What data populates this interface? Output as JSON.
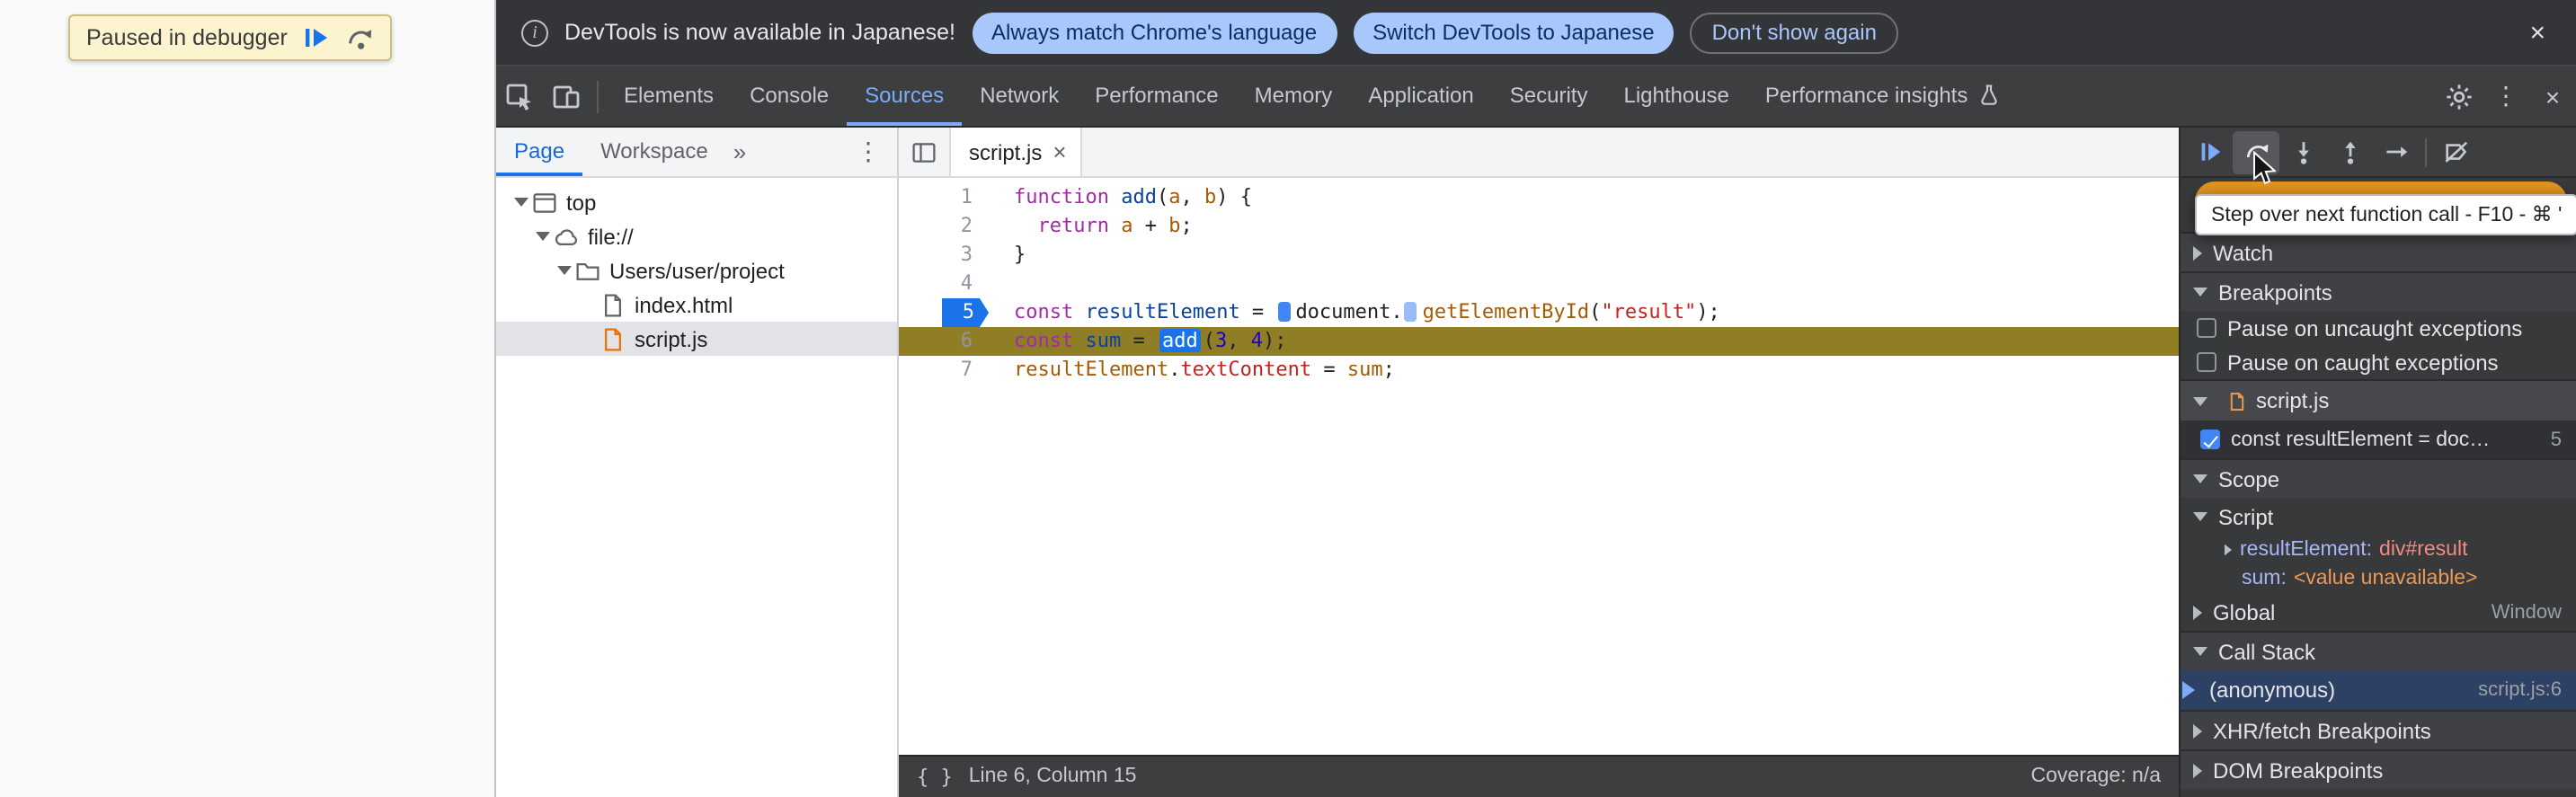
{
  "page": {
    "banner": {
      "text": "Paused in debugger"
    }
  },
  "icons": {
    "info": "i",
    "close": "×",
    "more": "⋮",
    "chevrons": "»",
    "list": [
      "info-icon",
      "close-icon",
      "inspect-element-icon",
      "device-toolbar-icon",
      "flask-icon",
      "settings-gear-icon",
      "more-options-icon",
      "toggle-navigator-icon",
      "frame-icon",
      "cloud-icon",
      "folder-icon",
      "file-icon",
      "resume-icon",
      "step-over-icon",
      "step-into-icon",
      "step-out-icon",
      "step-icon",
      "deactivate-breakpoints-icon",
      "pretty-print-icon",
      "breakpoint-marker",
      "inline-breakpoint-marker",
      "mouse-cursor"
    ]
  },
  "infobar": {
    "message": "DevTools is now available in Japanese!",
    "buttons": [
      "Always match Chrome's language",
      "Switch DevTools to Japanese",
      "Don't show again"
    ]
  },
  "toolbar": {
    "tabs": [
      "Elements",
      "Console",
      "Sources",
      "Network",
      "Performance",
      "Memory",
      "Application",
      "Security",
      "Lighthouse",
      "Performance insights"
    ],
    "selected_tab": "Sources"
  },
  "navigator": {
    "tabs": [
      "Page",
      "Workspace"
    ],
    "selected_tab": "Page",
    "tree": [
      {
        "label": "top"
      },
      {
        "label": "file://"
      },
      {
        "label": "Users/user/project"
      },
      {
        "label": "index.html"
      },
      {
        "label": "script.js"
      }
    ]
  },
  "editor": {
    "tab": "script.js",
    "gutter": [
      "1",
      "2",
      "3",
      "4",
      "5",
      "6",
      "7"
    ],
    "breakpoint_line": 5,
    "paused_line": 6,
    "code": [
      [
        "function",
        " ",
        "add",
        "(",
        "a",
        ", ",
        "b",
        ") {"
      ],
      [
        "  ",
        "return",
        " ",
        "a",
        " + ",
        "b",
        ";"
      ],
      [
        "}"
      ],
      [
        ""
      ],
      [
        "const",
        " ",
        "resultElement",
        " = ",
        "document",
        ".",
        "getElementById",
        "(",
        "\"result\"",
        ");"
      ],
      [
        "const",
        " ",
        "sum",
        " = ",
        "add",
        "(",
        "3",
        ", ",
        "4",
        ");"
      ],
      [
        "resultElement",
        ".",
        "textContent",
        " = ",
        "sum",
        ";"
      ]
    ],
    "status": {
      "braces": "{ }",
      "position": "Line 6, Column 15",
      "coverage": "Coverage: n/a"
    }
  },
  "sidebar": {
    "tooltip": "Step over next function call - F10 - ⌘ '",
    "watch": "Watch",
    "breakpoints": "Breakpoints",
    "pause_uncaught": "Pause on uncaught exceptions",
    "pause_caught": "Pause on caught exceptions",
    "bp_group_file": "script.js",
    "bp_entry": "const resultElement = doc…",
    "bp_entry_line": "5",
    "scope": "Scope",
    "scope_script": "Script",
    "var_result_name": "resultElement:",
    "var_result_value": "div#result",
    "var_sum_name": "sum:",
    "var_sum_value": "<value unavailable>",
    "global": "Global",
    "global_value": "Window",
    "callstack": "Call Stack",
    "frame_name": "(anonymous)",
    "frame_location": "script.js:6",
    "xhr": "XHR/fetch Breakpoints",
    "dom": "DOM Breakpoints"
  },
  "colors": {
    "accent_blue": "#1a73e8",
    "selected_tab_blue": "#7cacf8",
    "breakpoint_blue": "#1a73e8",
    "paused_line_olive": "#8f7e26",
    "infobar_button_blue": "#a8c7fa",
    "paused_banner_yellow": "#fcf3cf",
    "paused_indicator_orange": "#e0931f",
    "callstack_selected_blue": "#2d4164"
  }
}
